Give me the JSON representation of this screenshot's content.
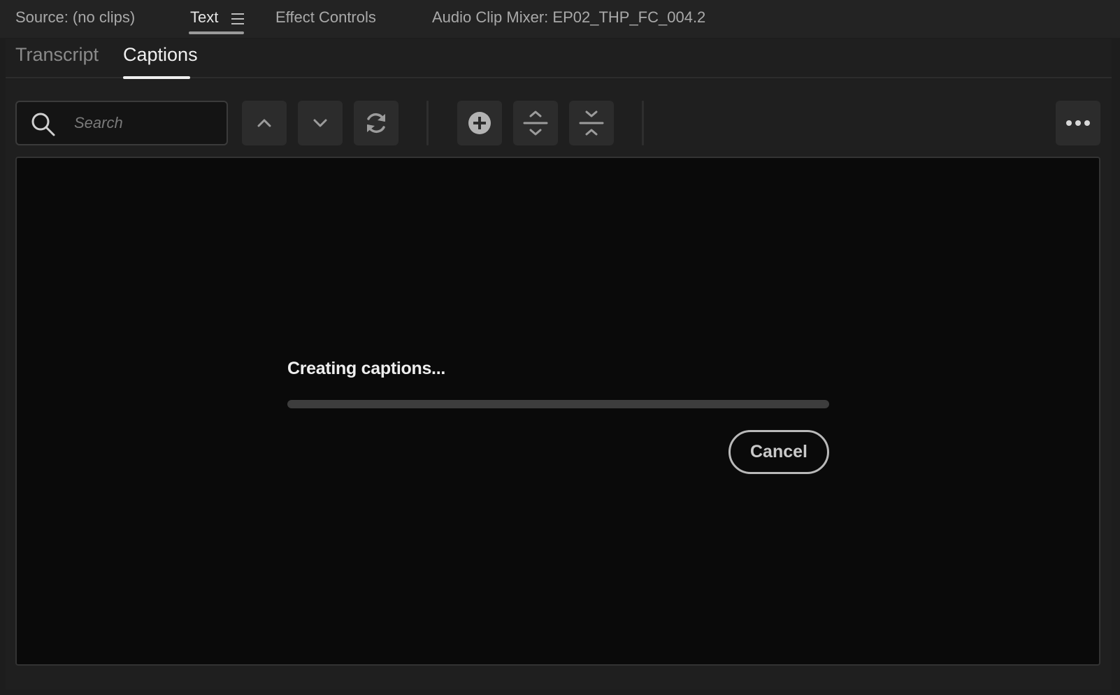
{
  "panel_tabs": [
    {
      "label": "Source: (no clips)"
    },
    {
      "label": "Text"
    },
    {
      "label": "Effect Controls"
    },
    {
      "label": "Audio Clip Mixer: EP02_THP_FC_004.2"
    }
  ],
  "active_panel_tab": "Text",
  "subtabs": [
    {
      "label": "Transcript"
    },
    {
      "label": "Captions"
    }
  ],
  "active_subtab": "Captions",
  "search": {
    "placeholder": "Search",
    "value": ""
  },
  "toolbar": {
    "icons": [
      "search-icon",
      "chevron-up-icon",
      "chevron-down-icon",
      "refresh-icon",
      "plus-circle-icon",
      "expand-icon",
      "collapse-icon",
      "more-icon"
    ]
  },
  "status": {
    "message": "Creating captions...",
    "progress": 0,
    "cancel_label": "Cancel"
  }
}
